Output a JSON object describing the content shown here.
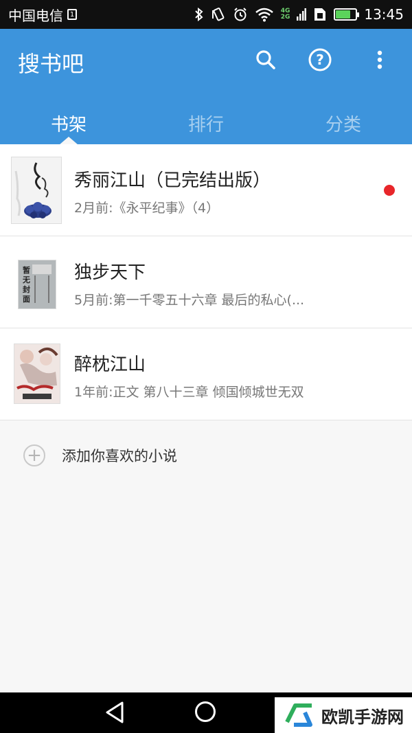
{
  "status_bar": {
    "carrier": "中国电信",
    "sim_label": "1",
    "network": [
      "4G",
      "2G"
    ],
    "time": "13:45",
    "battery_level": 0.75,
    "icons": [
      "bluetooth-icon",
      "vibrate-icon",
      "alarm-icon",
      "wifi-icon",
      "signal-icon",
      "sim-icon",
      "battery-icon"
    ]
  },
  "app_bar": {
    "title": "搜书吧",
    "actions": [
      "search-icon",
      "help-icon",
      "more-vert-icon"
    ],
    "help_glyph": "?"
  },
  "tabs": [
    {
      "label": "书架",
      "active": true
    },
    {
      "label": "排行",
      "active": false
    },
    {
      "label": "分类",
      "active": false
    }
  ],
  "books": [
    {
      "title": "秀丽江山（已完结出版）",
      "subtitle": "2月前:《永平纪事》（4）",
      "has_update": true
    },
    {
      "title": "独步天下",
      "subtitle": "5月前:第一千零五十六章 最后的私心(...",
      "has_update": false,
      "cover_text": [
        "暂",
        "无",
        "封",
        "面"
      ]
    },
    {
      "title": "醉枕江山",
      "subtitle": "1年前:正文 第八十三章 倾国倾城世无双",
      "has_update": false
    }
  ],
  "add_action": {
    "label": "添加你喜欢的小说",
    "icon_glyph": "+"
  },
  "watermark": {
    "label": "欧凯手游网"
  },
  "colors": {
    "primary": "#3d94dc",
    "accent_dot": "#e8262a",
    "status_bar": "#101010"
  }
}
